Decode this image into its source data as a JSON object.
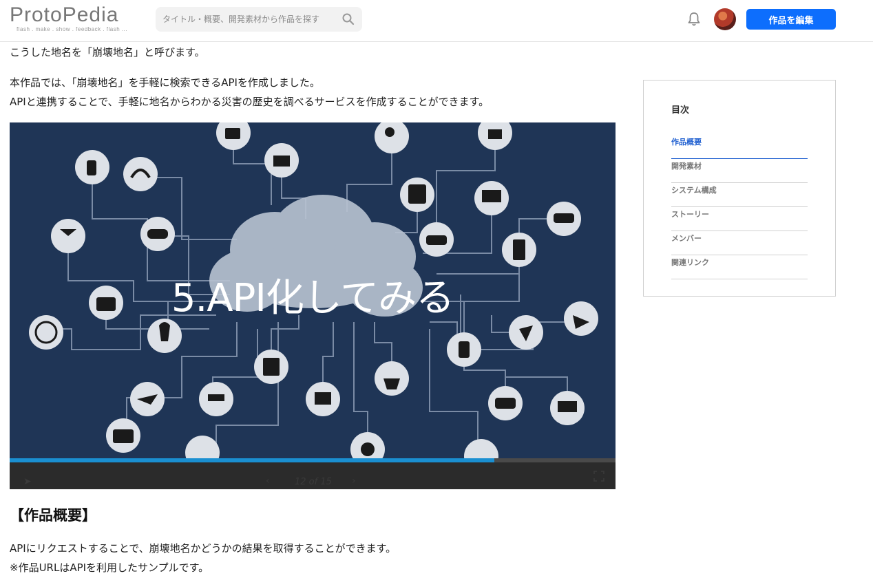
{
  "header": {
    "logo": "ProtoPedia",
    "tagline": "flash . make . show . feedback . flash ...",
    "search_placeholder": "タイトル・概要、開発素材から作品を探す",
    "edit_button": "作品を編集"
  },
  "content": {
    "line1": "こうした地名を「崩壊地名」と呼びます。",
    "line2": "本作品では、「崩壊地名」を手軽に検索できるAPIを作成しました。",
    "line3": "APIと連携することで、手軽に地名からわかる災害の歴史を調べるサービスを作成することができます。",
    "overview_heading": "【作品概要】",
    "overview_line1": "APIにリクエストすることで、崩壊地名かどうかの結果を取得することができます。",
    "overview_line2": "※作品URLはAPIを利用したサンプルです。"
  },
  "slide": {
    "title": "5.API化してみる",
    "counter": "12 of 15",
    "progress": 0.8
  },
  "toc": {
    "title": "目次",
    "items": [
      "作品概要",
      "開発素材",
      "システム構成",
      "ストーリー",
      "メンバー",
      "関連リンク"
    ]
  },
  "colors": {
    "accent": "#0d6efd",
    "slide_bg": "#1f3556",
    "progress": "#1a8fd1",
    "toc_active": "#1f5fd0"
  }
}
